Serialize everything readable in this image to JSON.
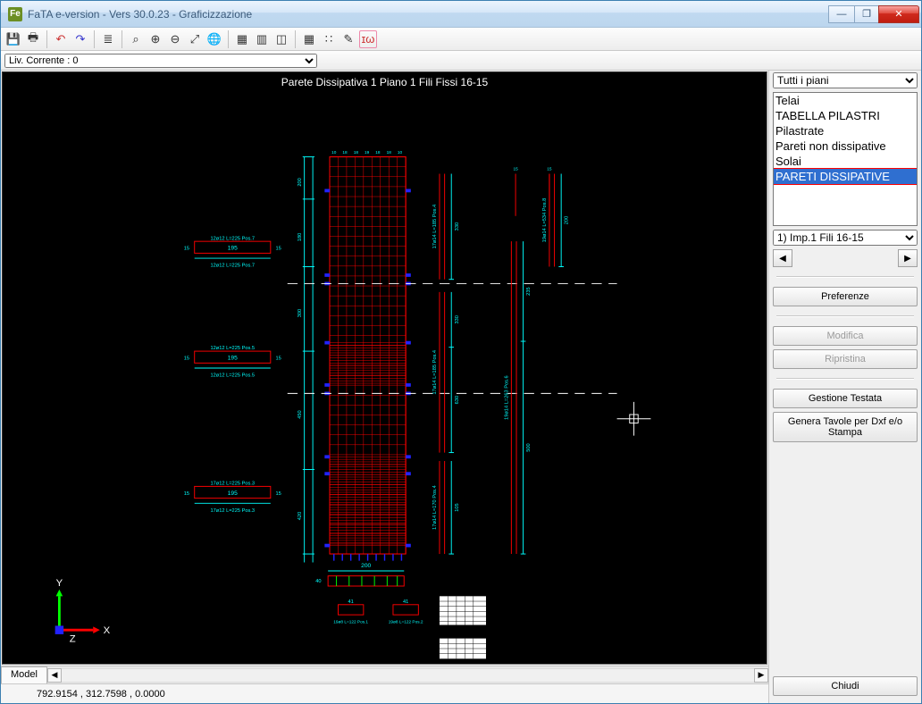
{
  "window": {
    "title": "FaTA e-version - Vers 30.0.23 - Graficizzazione"
  },
  "toolbar": {
    "icons": [
      "save",
      "print",
      "undo",
      "redo",
      "layers",
      "zoom-area",
      "zoom-in",
      "zoom-out",
      "zoom-ext",
      "globe",
      "view1",
      "view2",
      "view3",
      "grid1",
      "grid2",
      "measure",
      "mode"
    ]
  },
  "levelbar": {
    "current": "Liv. Corrente : 0"
  },
  "canvas": {
    "title": "Parete Dissipativa 1   Piano 1   Fili Fissi 16-15",
    "left_boxes": [
      {
        "top": "12ø12 L=225 Pos.7",
        "mid": "195",
        "bot": "12ø12 L=225 Pos.7"
      },
      {
        "top": "12ø12 L=225 Pos.5",
        "mid": "195",
        "bot": "12ø12 L=225 Pos.5"
      },
      {
        "top": "17ø12 L=225 Pos.3",
        "mid": "195",
        "bot": "17ø12 L=225 Pos.3"
      }
    ],
    "dims_left": [
      "200",
      "180",
      "300",
      "450",
      "420"
    ],
    "vlabel_a": "17ø14 L=170 Pos.4",
    "vlabel_b": "17ø14 L=185 Pos.4",
    "vlabel_c": "19ø14 L=263 Pos.6",
    "vlabel_d": "19ø14 L=534 Pos.8",
    "dims_right_a": [
      "105",
      "330",
      "630"
    ],
    "dims_right_b": [
      "235",
      "500"
    ],
    "dims_right_c": [
      "200"
    ],
    "bottom_dim": "200",
    "staffe": [
      {
        "top": "41",
        "bot": "19ø8 L=122 Pos.1"
      },
      {
        "top": "41",
        "bot": "19ø8 L=122 Pos.2"
      }
    ],
    "sec_dim_l": "40",
    "end_marks": [
      "10",
      "18",
      "18",
      "19",
      "18",
      "18",
      "10"
    ]
  },
  "tabs": {
    "model": "Model"
  },
  "status": {
    "coords": "792.9154 , 312.7598 , 0.0000"
  },
  "right": {
    "plan_select": "Tutti i piani",
    "list": [
      "Telai",
      "TABELLA PILASTRI",
      "Pilastrate",
      "Pareti non dissipative",
      "Solai",
      "PARETI DISSIPATIVE"
    ],
    "selected_index": 5,
    "imp_select": "1) Imp.1 Fili 16-15",
    "btn_pref": "Preferenze",
    "btn_modifica": "Modifica",
    "btn_riprist": "Ripristina",
    "btn_testata": "Gestione Testata",
    "btn_genera": "Genera Tavole per Dxf e/o Stampa",
    "btn_chiudi": "Chiudi"
  }
}
